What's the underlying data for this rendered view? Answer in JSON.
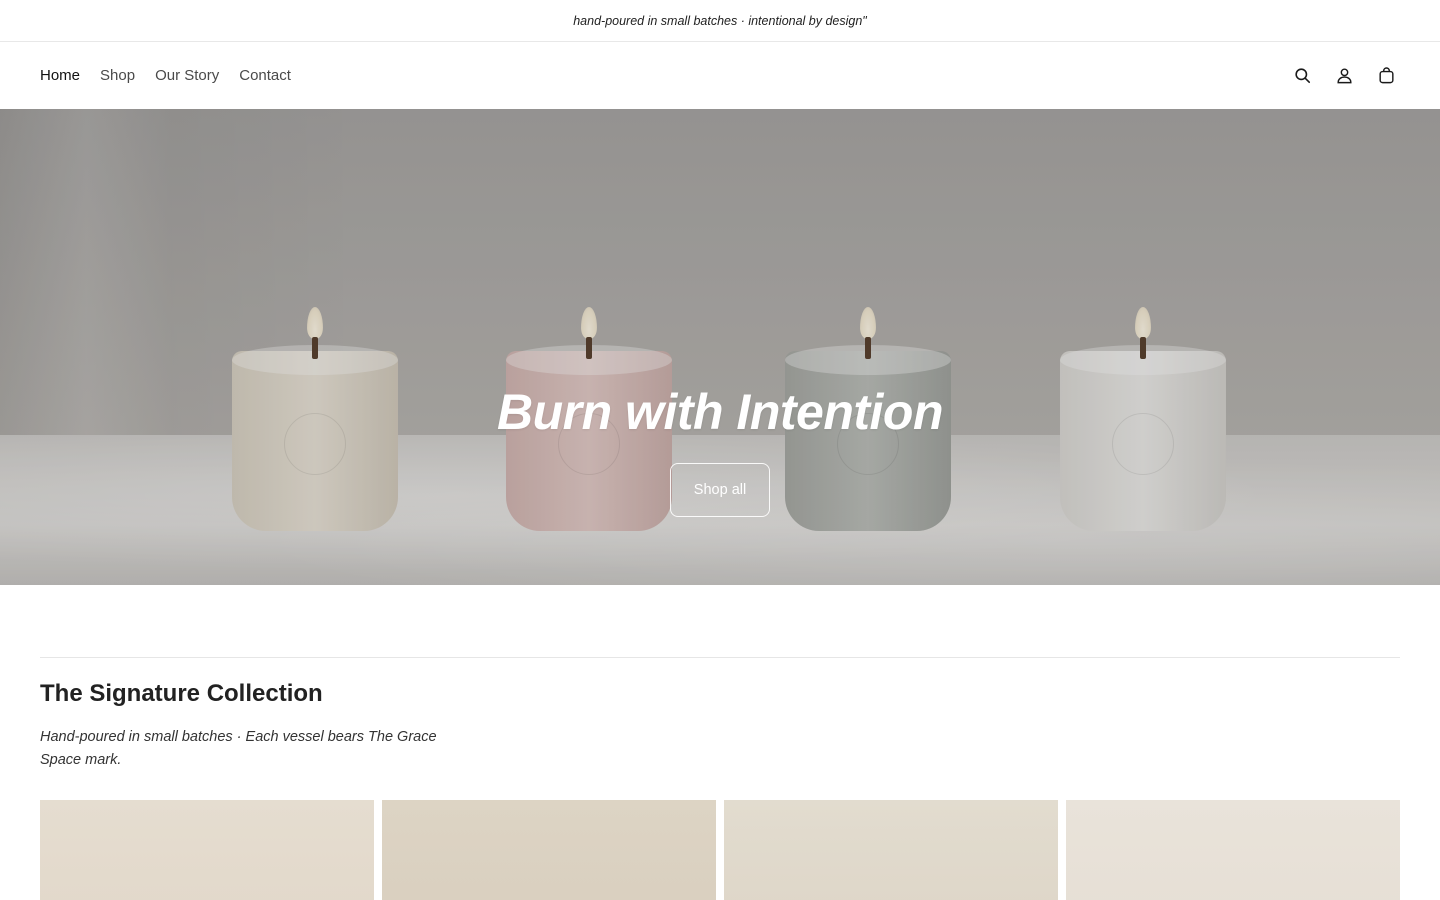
{
  "announcement": {
    "text": "hand-poured in small batches · intentional by design\""
  },
  "nav": {
    "items": [
      {
        "label": "Home",
        "active": true
      },
      {
        "label": "Shop",
        "active": false
      },
      {
        "label": "Our Story",
        "active": false
      },
      {
        "label": "Contact",
        "active": false
      }
    ]
  },
  "header_icons": [
    "search-icon",
    "account-icon",
    "cart-icon"
  ],
  "hero": {
    "title": "Burn with Intention",
    "button_label": "Shop all"
  },
  "collection": {
    "title": "The Signature Collection",
    "description": "Hand-poured in small batches · Each vessel bears The Grace Space mark."
  },
  "colors": {
    "text": "#1f1f1f",
    "border": "#e8e8e8",
    "hero_text": "#ffffff"
  }
}
